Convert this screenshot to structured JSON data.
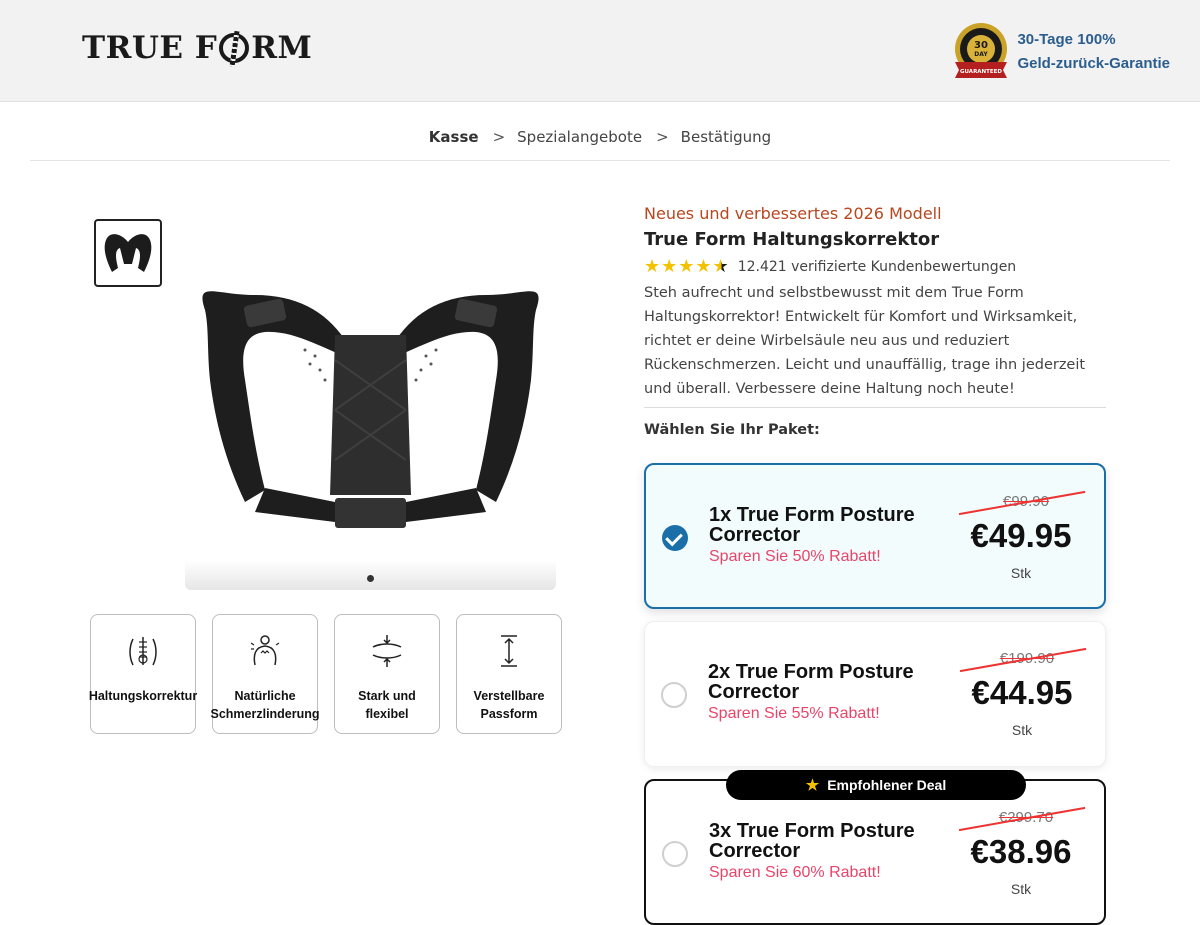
{
  "header": {
    "logo_left": "TRUE F",
    "logo_right": "RM",
    "seal_text": "MONEY BACK 30 DAY GUARANTEED",
    "guarantee_line1": "30-Tage 100%",
    "guarantee_line2": "Geld-zurück-Garantie"
  },
  "breadcrumb": {
    "items": [
      "Kasse",
      "Spezialangebote",
      "Bestätigung"
    ],
    "separator": ">"
  },
  "gallery": {
    "thumb_icon": "posture-corrector-thumbnail",
    "main_icon": "posture-corrector-image"
  },
  "features": [
    {
      "icon": "spine-icon",
      "label": "Haltungskorrektur"
    },
    {
      "icon": "back-pain-icon",
      "label": "Natürliche Schmerzlinderung"
    },
    {
      "icon": "flex-arrows-icon",
      "label": "Stark und flexibel"
    },
    {
      "icon": "vertical-arrow-icon",
      "label": "Verstellbare Passform"
    }
  ],
  "product": {
    "kicker": "Neues und verbessertes 2026 Modell",
    "title": "True Form Haltungskorrektor",
    "rating_value": 4.5,
    "reviews": "12.421 verifizierte Kundenbewertungen",
    "description": "Steh aufrecht und selbstbewusst mit dem True Form Haltungskorrektor! Entwickelt für Komfort und Wirksamkeit, richtet er deine Wirbelsäule neu aus und reduziert Rückenschmerzen. Leicht und unauffällig, trage ihn jederzeit und überall. Verbessere deine Haltung noch heute!",
    "choose_label": "Wählen Sie Ihr Paket:"
  },
  "packages": [
    {
      "name": "1x True Form Posture Corrector",
      "save": "Sparen Sie 50% Rabatt!",
      "old_price": "€99.90",
      "price": "€49.95",
      "unit": "Stk",
      "selected": true
    },
    {
      "name": "2x True Form Posture Corrector",
      "save": "Sparen Sie 55% Rabatt!",
      "old_price": "€199.90",
      "price": "€44.95",
      "unit": "Stk",
      "selected": false
    },
    {
      "name": "3x True Form Posture Corrector",
      "save": "Sparen Sie 60% Rabatt!",
      "old_price": "€299.70",
      "price": "€38.96",
      "unit": "Stk",
      "selected": false,
      "badge": "Empfohlener Deal"
    }
  ],
  "colors": {
    "accent_blue": "#1a6fa8",
    "save_pink": "#e8456a",
    "kicker_orange": "#b8461f",
    "star_yellow": "#f2c200"
  }
}
